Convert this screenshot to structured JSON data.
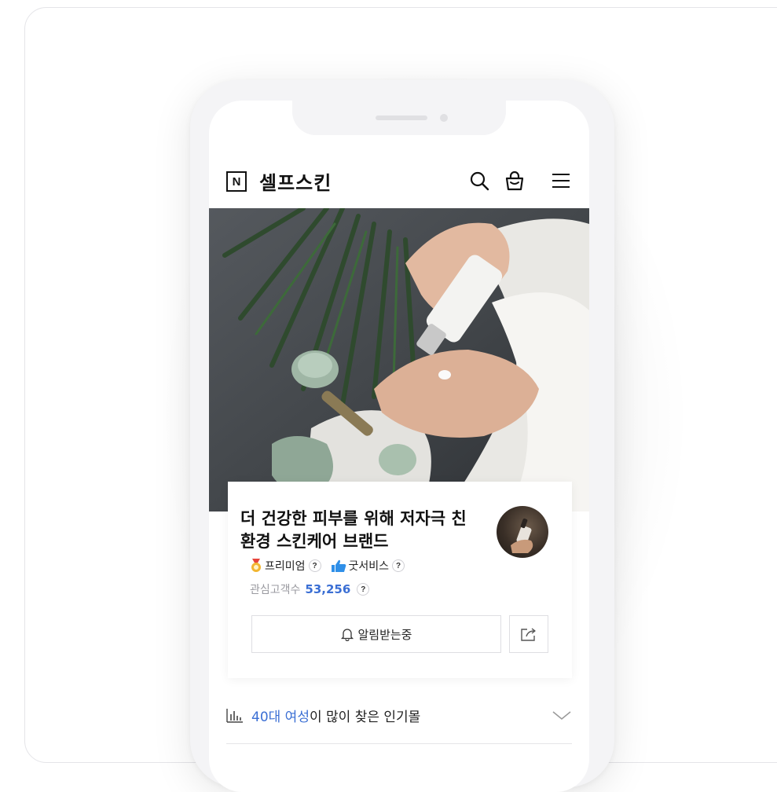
{
  "header": {
    "logo_letter": "N",
    "store_name": "셀프스킨"
  },
  "store": {
    "title_line1": "더 건강한 피부를 위해 저자극 친",
    "title_line2": "환경 스킨케어 브랜드",
    "badges": [
      {
        "label": "프리미엄",
        "help": "?"
      },
      {
        "label": "굿서비스",
        "help": "?"
      }
    ],
    "interest_label": "관심고객수",
    "interest_count": "53,256",
    "interest_help": "?",
    "alert_button": "알림받는중"
  },
  "popular": {
    "highlight": "40대 여성",
    "rest": "이 많이 찾은 인기몰"
  },
  "icons": {
    "logo": "naver-n-logo",
    "search": "search-icon",
    "bag": "shopping-bag-icon",
    "menu": "hamburger-menu-icon",
    "premium": "medal-icon",
    "goodservice": "thumbs-up-icon",
    "bell": "bell-icon",
    "share": "share-icon",
    "chart": "bar-chart-icon",
    "expand": "chevron-down-icon"
  },
  "colors": {
    "accent_blue": "#3b6fd4",
    "medal_gold": "#f2b632",
    "thumb_blue": "#2f8fe8"
  }
}
